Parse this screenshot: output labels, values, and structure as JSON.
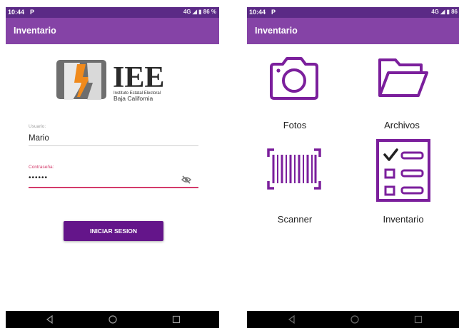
{
  "status_bar": {
    "time": "10:44",
    "carrier_icon": "P",
    "left_right": "4G ◢ ▮ 86 %",
    "right_right": "4G ◢ ▮ 86"
  },
  "app_bar": {
    "title": "Inventario"
  },
  "logo": {
    "main": "IEE",
    "line1": "Instituto Estatal Electoral",
    "line2": "Baja California"
  },
  "login": {
    "user_label": "Usuario:",
    "user_value": "Mario",
    "password_label": "Contraseña:",
    "password_value": "••••••",
    "toggle_icon": "eye-off-icon",
    "button": "INICIAR SESION"
  },
  "menu": {
    "items": [
      {
        "label": "Fotos",
        "icon": "camera-icon"
      },
      {
        "label": "Archivos",
        "icon": "folder-icon"
      },
      {
        "label": "Scanner",
        "icon": "barcode-icon"
      },
      {
        "label": "Inventario",
        "icon": "checklist-icon"
      }
    ]
  },
  "nav_icons": [
    "back-icon",
    "home-icon",
    "recents-icon"
  ],
  "colors": {
    "status_bar": "#5b2a86",
    "app_bar": "#8543a6",
    "accent": "#7b1f9c",
    "button": "#64158a",
    "error": "#d33a6a"
  }
}
